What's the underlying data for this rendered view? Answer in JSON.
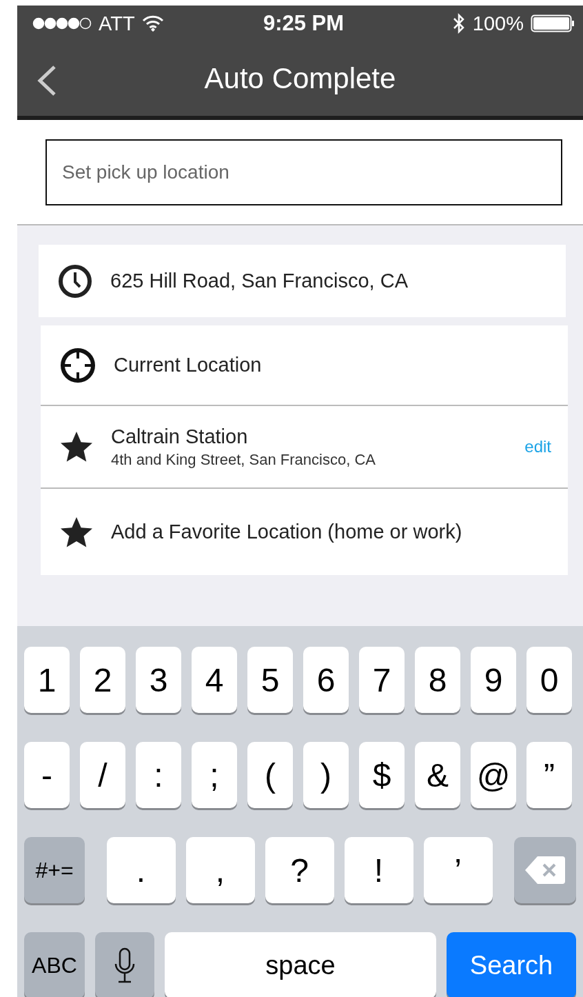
{
  "status_bar": {
    "carrier": "ATT",
    "time": "9:25 PM",
    "battery": "100%"
  },
  "nav_bar": {
    "title": "Auto Complete"
  },
  "search": {
    "placeholder": "Set pick up location"
  },
  "recent": [
    {
      "kind": "clock",
      "title": "625 Hill Road, San Francisco, CA"
    }
  ],
  "favorites": [
    {
      "kind": "crosshair",
      "title": "Current Location"
    },
    {
      "kind": "star",
      "title": "Caltrain Station",
      "subtitle": "4th and King Street, San Francisco, CA",
      "action": "edit"
    },
    {
      "kind": "star",
      "title": "Add a Favorite Location (home or work)"
    }
  ],
  "keyboard": {
    "rows": [
      {
        "keys": [
          {
            "kind": "char",
            "label": "1"
          },
          {
            "kind": "char",
            "label": "2"
          },
          {
            "kind": "char",
            "label": "3"
          },
          {
            "kind": "char",
            "label": "4"
          },
          {
            "kind": "char",
            "label": "5"
          },
          {
            "kind": "char",
            "label": "6"
          },
          {
            "kind": "char",
            "label": "7"
          },
          {
            "kind": "char",
            "label": "8"
          },
          {
            "kind": "char",
            "label": "9"
          },
          {
            "kind": "char",
            "label": "0"
          }
        ]
      },
      {
        "keys": [
          {
            "kind": "char",
            "label": "-"
          },
          {
            "kind": "char",
            "label": "/"
          },
          {
            "kind": "char",
            "label": ":"
          },
          {
            "kind": "char",
            "label": ";"
          },
          {
            "kind": "char",
            "label": "("
          },
          {
            "kind": "char",
            "label": ")"
          },
          {
            "kind": "char",
            "label": "$"
          },
          {
            "kind": "char",
            "label": "&"
          },
          {
            "kind": "char",
            "label": "@"
          },
          {
            "kind": "char",
            "label": "”"
          }
        ]
      },
      {
        "keys": [
          {
            "kind": "function",
            "label": "#+="
          },
          {
            "kind": "wide",
            "label": "."
          },
          {
            "kind": "wide",
            "label": ","
          },
          {
            "kind": "wide",
            "label": "?"
          },
          {
            "kind": "wide",
            "label": "!"
          },
          {
            "kind": "wide",
            "label": "’"
          },
          {
            "kind": "backspace"
          }
        ]
      },
      {
        "keys": [
          {
            "kind": "function",
            "label": "ABC"
          },
          {
            "kind": "mic"
          },
          {
            "kind": "space",
            "label": "space"
          },
          {
            "kind": "action",
            "label": "Search"
          }
        ]
      }
    ]
  }
}
